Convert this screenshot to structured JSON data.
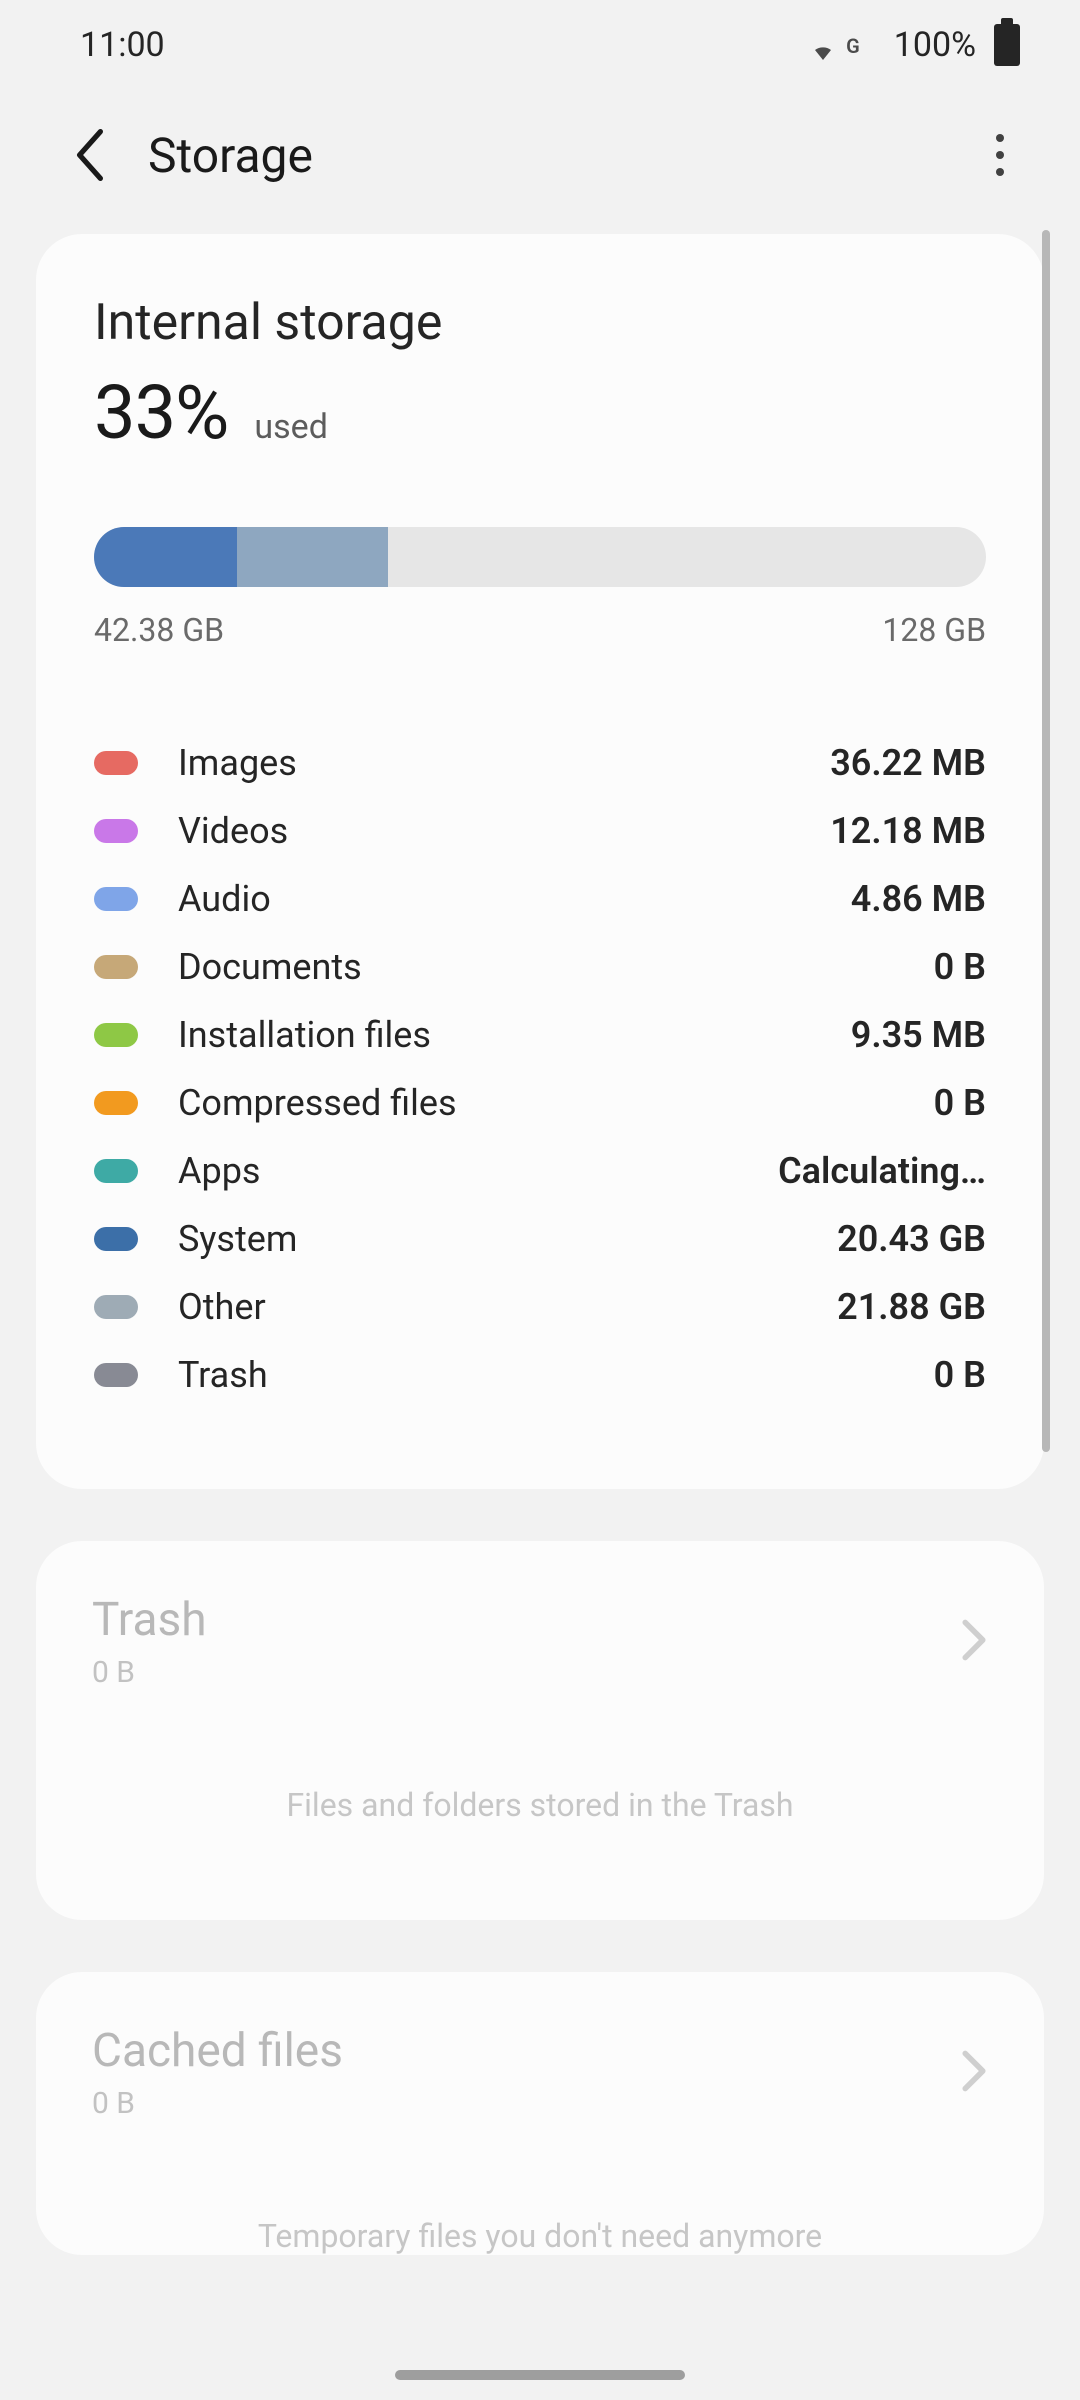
{
  "status": {
    "time": "11:00",
    "network_indicator": "G",
    "battery_pct": "100%"
  },
  "header": {
    "title": "Storage"
  },
  "storage": {
    "section_title": "Internal storage",
    "used_pct": "33%",
    "used_label": "used",
    "used_amount": "42.38 GB",
    "total_amount": "128 GB",
    "bar_seg1_pct": 16,
    "bar_seg2_pct": 17,
    "categories": [
      {
        "label": "Images",
        "size": "36.22 MB",
        "color": "#e66a62"
      },
      {
        "label": "Videos",
        "size": "12.18 MB",
        "color": "#c978e8"
      },
      {
        "label": "Audio",
        "size": "4.86 MB",
        "color": "#7fa5e8"
      },
      {
        "label": "Documents",
        "size": "0 B",
        "color": "#c6a878"
      },
      {
        "label": "Installation files",
        "size": "9.35 MB",
        "color": "#8ec845"
      },
      {
        "label": "Compressed files",
        "size": "0 B",
        "color": "#f29a1f"
      },
      {
        "label": "Apps",
        "size": "Calculating…",
        "color": "#3eaaa5"
      },
      {
        "label": "System",
        "size": "20.43 GB",
        "color": "#3c6fa8"
      },
      {
        "label": "Other",
        "size": "21.88 GB",
        "color": "#9eabb5"
      },
      {
        "label": "Trash",
        "size": "0 B",
        "color": "#888a94"
      }
    ]
  },
  "trash_card": {
    "title": "Trash",
    "size": "0 B",
    "desc": "Files and folders stored in the Trash"
  },
  "cached_card": {
    "title": "Cached files",
    "size": "0 B",
    "desc": "Temporary files you don't need anymore"
  }
}
